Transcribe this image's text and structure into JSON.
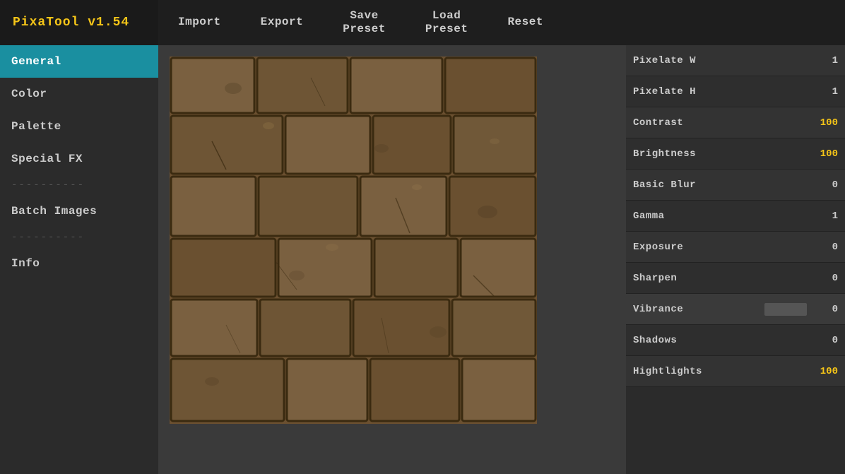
{
  "app": {
    "title": "PixaTool v1.54"
  },
  "topbar": {
    "buttons": [
      {
        "id": "import",
        "label": "Import"
      },
      {
        "id": "export",
        "label": "Export"
      },
      {
        "id": "save-preset",
        "label": "Save\nPreset"
      },
      {
        "id": "load-preset",
        "label": "Load\nPreset"
      },
      {
        "id": "reset",
        "label": "Reset"
      }
    ]
  },
  "sidebar": {
    "items": [
      {
        "id": "general",
        "label": "General",
        "active": true
      },
      {
        "id": "color",
        "label": "Color",
        "active": false
      },
      {
        "id": "palette",
        "label": "Palette",
        "active": false
      },
      {
        "id": "special-fx",
        "label": "Special FX",
        "active": false
      },
      {
        "id": "sep1",
        "label": "----------",
        "separator": true
      },
      {
        "id": "batch-images",
        "label": "Batch Images",
        "active": false
      },
      {
        "id": "sep2",
        "label": "----------",
        "separator": true
      },
      {
        "id": "info",
        "label": "Info",
        "active": false
      }
    ]
  },
  "params": [
    {
      "id": "pixelate-w",
      "label": "Pixelate W",
      "value": "1",
      "color": "white"
    },
    {
      "id": "pixelate-h",
      "label": "Pixelate H",
      "value": "1",
      "color": "white"
    },
    {
      "id": "contrast",
      "label": "Contrast",
      "value": "100",
      "color": "yellow"
    },
    {
      "id": "brightness",
      "label": "Brightness",
      "value": "100",
      "color": "yellow"
    },
    {
      "id": "basic-blur",
      "label": "Basic Blur",
      "value": "0",
      "color": "white"
    },
    {
      "id": "gamma",
      "label": "Gamma",
      "value": "1",
      "color": "white"
    },
    {
      "id": "exposure",
      "label": "Exposure",
      "value": "0",
      "color": "white"
    },
    {
      "id": "sharpen",
      "label": "Sharpen",
      "value": "0",
      "color": "white"
    },
    {
      "id": "vibrance",
      "label": "Vibrance",
      "value": "0",
      "color": "white",
      "hasBar": true
    },
    {
      "id": "shadows",
      "label": "Shadows",
      "value": "0",
      "color": "white"
    },
    {
      "id": "highlights",
      "label": "Hightlights",
      "value": "100",
      "color": "yellow"
    }
  ],
  "colors": {
    "accent": "#1a8fa0",
    "yellow": "#f5c518",
    "bg_dark": "#1e1e1e",
    "bg_mid": "#2b2b2b",
    "bg_light": "#333333"
  }
}
